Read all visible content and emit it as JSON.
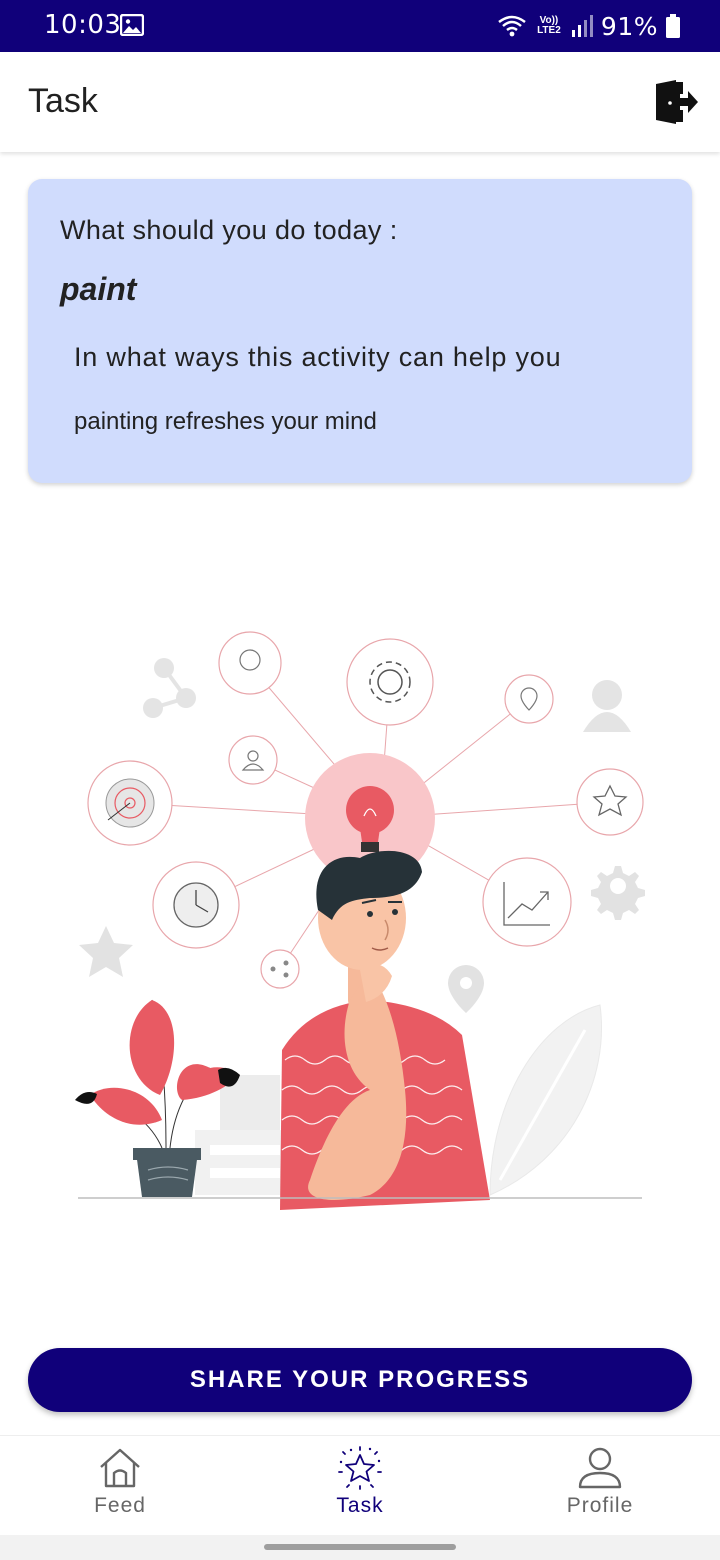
{
  "status_bar": {
    "time": "10:03",
    "network_label": "Vo)) LTE2",
    "battery": "91%",
    "icons": [
      "image-icon",
      "wifi-icon",
      "signal-icon",
      "battery-icon"
    ]
  },
  "app_bar": {
    "title": "Task",
    "logout_icon": "logout-door-icon"
  },
  "task_card": {
    "question_label": "What should you do today :",
    "activity": "paint",
    "help_label": "In what ways this activity can help you",
    "help_text": "painting refreshes your mind"
  },
  "illustration": {
    "subject": "thinking-person-with-lightbulb-illustration"
  },
  "share_button": {
    "label": "SHARE YOUR PROGRESS"
  },
  "bottom_nav": {
    "items": [
      {
        "label": "Feed",
        "icon": "home-icon",
        "active": false
      },
      {
        "label": "Task",
        "icon": "star-icon",
        "active": true
      },
      {
        "label": "Profile",
        "icon": "person-icon",
        "active": false
      }
    ]
  },
  "colors": {
    "primary": "#10007a",
    "card_background": "#d0dcfd",
    "accent_red": "#e85a63"
  }
}
